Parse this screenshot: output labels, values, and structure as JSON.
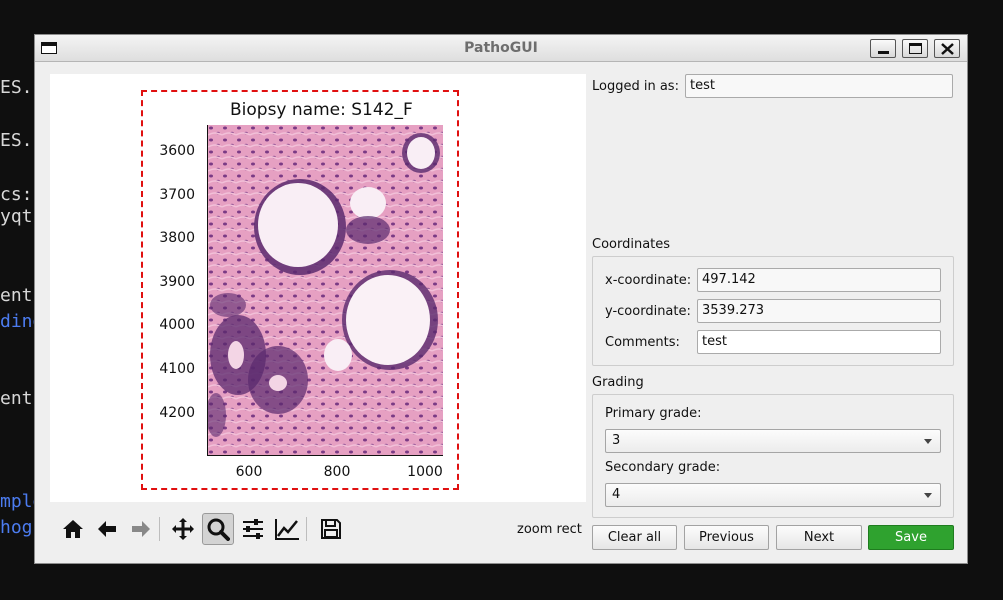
{
  "terminal": {
    "lines": [
      "ES.r",
      "ES.r",
      "cs:",
      "yqt!",
      "ent",
      "ding",
      "ent",
      "mple",
      "hog:"
    ]
  },
  "window": {
    "title": "PathoGUI"
  },
  "plot": {
    "title": "Biopsy name: S142_F",
    "y_ticks": [
      "3600",
      "3700",
      "3800",
      "3900",
      "4000",
      "4100",
      "4200"
    ],
    "x_ticks": [
      "600",
      "800",
      "1000"
    ],
    "selection_color": "#e01010"
  },
  "toolbar": {
    "icons": [
      "home-icon",
      "back-arrow-icon",
      "forward-arrow-icon",
      "pan-icon",
      "zoom-icon",
      "configure-subplots-icon",
      "edit-axes-icon",
      "save-figure-icon"
    ],
    "mode_text": "zoom rect"
  },
  "login": {
    "label": "Logged in as:",
    "value": "test"
  },
  "coordinates": {
    "title": "Coordinates",
    "x_label": "x-coordinate:",
    "x_value": "497.142",
    "y_label": "y-coordinate:",
    "y_value": "3539.273",
    "comments_label": "Comments:",
    "comments_value": "test"
  },
  "grading": {
    "title": "Grading",
    "primary_label": "Primary grade:",
    "primary_value": "3",
    "secondary_label": "Secondary grade:",
    "secondary_value": "4"
  },
  "buttons": {
    "clear": "Clear all",
    "previous": "Previous",
    "next": "Next",
    "save": "Save"
  },
  "colors": {
    "save_button": "#2fa22f",
    "window_bg": "#efefef"
  }
}
